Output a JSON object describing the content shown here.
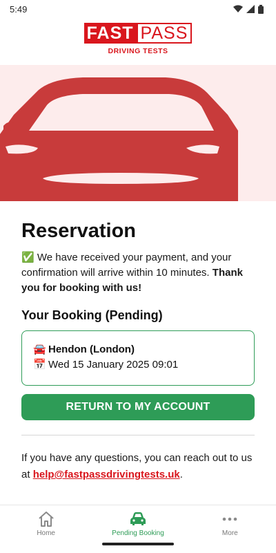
{
  "status_bar": {
    "time": "5:49"
  },
  "brand": {
    "word1": "FAST",
    "word2": "PASS",
    "tagline": "DRIVING TESTS",
    "color": "#d9161d"
  },
  "page": {
    "title": "Reservation",
    "message_icon": "✅",
    "message_text": " We have received your payment, and your confirmation will arrive within 10 minutes. ",
    "message_bold": "Thank you for booking with us!"
  },
  "booking": {
    "section_title": "Your Booking (Pending)",
    "location_icon": "🚘",
    "location": "Hendon (London)",
    "date_icon": "📅",
    "datetime": "Wed 15 January 2025 09:01"
  },
  "actions": {
    "return_label": "RETURN TO MY ACCOUNT"
  },
  "help": {
    "text": "If you have any questions, you can reach out to us at ",
    "email": "help@fastpassdrivingtests.uk",
    "suffix": "."
  },
  "nav": {
    "items": [
      {
        "label": "Home",
        "icon": "home-icon"
      },
      {
        "label": "Pending Booking",
        "icon": "car-icon"
      },
      {
        "label": "More",
        "icon": "more-icon"
      }
    ]
  },
  "colors": {
    "accent_green": "#2e9c57",
    "hero_bg": "#fdecec",
    "car_red": "#c83b3b"
  }
}
